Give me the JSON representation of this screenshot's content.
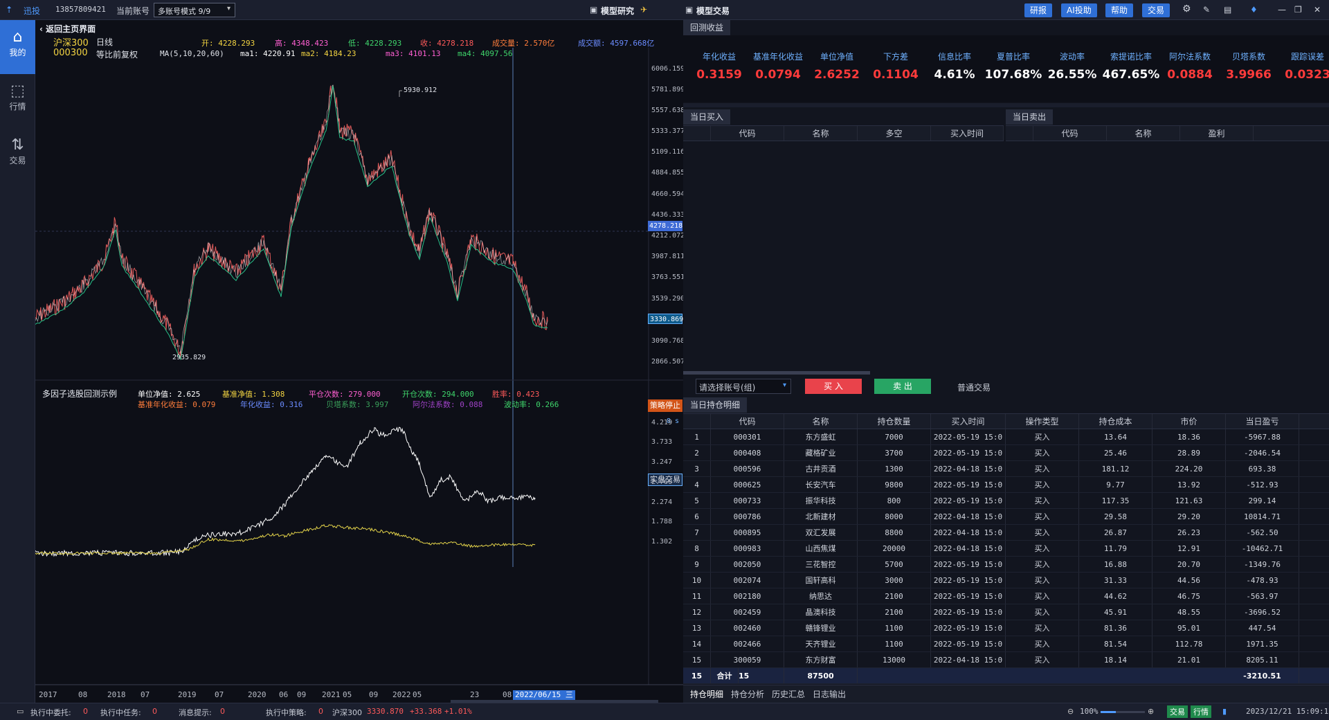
{
  "topbar": {
    "app_name": "迅投",
    "account_id": "13857809421",
    "current_account_label": "当前账号",
    "account_mode": "多账号模式 9/9",
    "model_research": "模型研究",
    "model_trade": "模型交易",
    "buttons": [
      "研报",
      "AI投助",
      "帮助",
      "交易"
    ]
  },
  "leftnav": [
    {
      "label": "我的",
      "icon": "home-icon"
    },
    {
      "label": "行情",
      "icon": "chart-icon"
    },
    {
      "label": "交易",
      "icon": "trade-icon"
    }
  ],
  "chart": {
    "back_label": "返回主页界面",
    "index_name": "沪深300",
    "period": "日线",
    "code": "000300",
    "adjust": "等比前复权",
    "ma_label": "MA(5,10,20,60)",
    "open": "开: 4228.293",
    "high": "高: 4348.423",
    "low": "低: 4228.293",
    "close": "收: 4278.218",
    "volume": "成交量: 2.570亿",
    "amount": "成交额: 4597.668亿",
    "ma1": "ma1: 4220.91",
    "ma2": "ma2: 4184.23",
    "ma3": "ma3: 4101.13",
    "ma4": "ma4: 4097.56",
    "peak_label": "5930.912",
    "trough_label": "2935.829",
    "current_tag": "4278.218",
    "last_tag": "3330.869",
    "crosshair_date": "2022/06/15 三",
    "strategy_title": "多因子选股回测示例",
    "s_unit_nav": "单位净值: 2.625",
    "s_bench_nav": "基准净值: 1.308",
    "s_close_count": "平仓次数: 279.000",
    "s_open_count": "开仓次数: 294.000",
    "s_win_rate": "胜率: 0.423",
    "s_bench_annual": "基准年化收益: 0.079",
    "s_annual": "年化收益: 0.316",
    "s_beta": "贝塔系数: 3.997",
    "s_alpha": "阿尔法系数: 0.088",
    "s_vol": "波动率: 0.266",
    "strategy_stop": "策略停止",
    "strategy_seconds": "8 s",
    "live_trade": "实盘交易",
    "price_axis": [
      "6006.159",
      "5781.899",
      "5557.638",
      "5333.377",
      "5109.116",
      "4884.855",
      "4660.594",
      "4436.333",
      "4212.072",
      "3987.811",
      "3763.551",
      "3539.290",
      "3090.768",
      "2866.507"
    ],
    "nav_axis": [
      "4.219",
      "3.733",
      "3.247",
      "2.760",
      "2.274",
      "1.788",
      "1.302"
    ],
    "x_axis": [
      "2017",
      "08",
      "2018",
      "07",
      "2019",
      "07",
      "2020",
      "06",
      "09",
      "2021",
      "05",
      "09",
      "2022",
      "05",
      "23",
      "08",
      "12"
    ]
  },
  "right": {
    "backtest_tab": "回测收益",
    "metrics": [
      {
        "k": "年化收益",
        "v": "0.3159",
        "c": "#ff3b3b"
      },
      {
        "k": "基准年化收益",
        "v": "0.0794",
        "c": "#ff3b3b"
      },
      {
        "k": "单位净值",
        "v": "2.6252",
        "c": "#ff3b3b"
      },
      {
        "k": "下方差",
        "v": "0.1104",
        "c": "#ff3b3b"
      },
      {
        "k": "信息比率",
        "v": "4.61%",
        "c": "#ffffff"
      },
      {
        "k": "夏普比率",
        "v": "107.68%",
        "c": "#ffffff"
      },
      {
        "k": "波动率",
        "v": "26.55%",
        "c": "#ffffff"
      },
      {
        "k": "索提诺比率",
        "v": "467.65%",
        "c": "#ffffff"
      },
      {
        "k": "阿尔法系数",
        "v": "0.0884",
        "c": "#ff3b3b"
      },
      {
        "k": "贝塔系数",
        "v": "3.9966",
        "c": "#ff3b3b"
      },
      {
        "k": "跟踪误差",
        "v": "0.0323",
        "c": "#ff3b3b"
      }
    ],
    "buy_tab": "当日买入",
    "sell_tab": "当日卖出",
    "buy_cols": [
      "代码",
      "名称",
      "多空",
      "买入时间"
    ],
    "sell_cols": [
      "代码",
      "名称",
      "盈利"
    ],
    "select_account": "请选择账号(组)",
    "buy_btn": "买 入",
    "sell_btn": "卖 出",
    "normal_trade": "普通交易",
    "pos_tab": "当日持仓明细",
    "pos_cols": [
      "",
      "代码",
      "名称",
      "持仓数量",
      "买入时间",
      "操作类型",
      "持仓成本",
      "市价",
      "当日盈亏"
    ],
    "positions": [
      [
        "1",
        "000301",
        "东方盛虹",
        "7000",
        "2022-05-19 15:0",
        "买入",
        "13.64",
        "18.36",
        "-5967.88"
      ],
      [
        "2",
        "000408",
        "藏格矿业",
        "3700",
        "2022-05-19 15:0",
        "买入",
        "25.46",
        "28.89",
        "-2046.54"
      ],
      [
        "3",
        "000596",
        "古井贡酒",
        "1300",
        "2022-04-18 15:0",
        "买入",
        "181.12",
        "224.20",
        "693.38"
      ],
      [
        "4",
        "000625",
        "长安汽车",
        "9800",
        "2022-05-19 15:0",
        "买入",
        "9.77",
        "13.92",
        "-512.93"
      ],
      [
        "5",
        "000733",
        "振华科技",
        "800",
        "2022-05-19 15:0",
        "买入",
        "117.35",
        "121.63",
        "299.14"
      ],
      [
        "6",
        "000786",
        "北新建材",
        "8000",
        "2022-04-18 15:0",
        "买入",
        "29.58",
        "29.20",
        "10814.71"
      ],
      [
        "7",
        "000895",
        "双汇发展",
        "8800",
        "2022-04-18 15:0",
        "买入",
        "26.87",
        "26.23",
        "-562.50"
      ],
      [
        "8",
        "000983",
        "山西焦煤",
        "20000",
        "2022-04-18 15:0",
        "买入",
        "11.79",
        "12.91",
        "-10462.71"
      ],
      [
        "9",
        "002050",
        "三花智控",
        "5700",
        "2022-05-19 15:0",
        "买入",
        "16.88",
        "20.70",
        "-1349.76"
      ],
      [
        "10",
        "002074",
        "国轩高科",
        "3000",
        "2022-05-19 15:0",
        "买入",
        "31.33",
        "44.56",
        "-478.93"
      ],
      [
        "11",
        "002180",
        "纳思达",
        "2100",
        "2022-05-19 15:0",
        "买入",
        "44.62",
        "46.75",
        "-563.97"
      ],
      [
        "12",
        "002459",
        "晶澳科技",
        "2100",
        "2022-05-19 15:0",
        "买入",
        "45.91",
        "48.55",
        "-3696.52"
      ],
      [
        "13",
        "002460",
        "赣锋锂业",
        "1100",
        "2022-05-19 15:0",
        "买入",
        "81.36",
        "95.01",
        "447.54"
      ],
      [
        "14",
        "002466",
        "天齐锂业",
        "1100",
        "2022-05-19 15:0",
        "买入",
        "81.54",
        "112.78",
        "1971.35"
      ],
      [
        "15",
        "300059",
        "东方财富",
        "13000",
        "2022-04-18 15:0",
        "买入",
        "18.14",
        "21.01",
        "8205.11"
      ]
    ],
    "total_row": [
      "15",
      "合计",
      "15",
      "87500",
      "-3210.51"
    ],
    "bottom_tabs": [
      "持仓明细",
      "持仓分析",
      "历史汇总",
      "日志输出"
    ]
  },
  "status": {
    "pending_orders": "执行中委托:",
    "pending_orders_n": "0",
    "running_tasks": "执行中任务:",
    "running_tasks_n": "0",
    "message": "消息提示:",
    "message_n": "0",
    "running_strategy": "执行中策略:",
    "running_strategy_n": "0",
    "index": "沪深300",
    "index_value": "3330.870",
    "index_change": "+33.368",
    "index_pct": "+1.01%",
    "zoom": "100%",
    "trade_btn": "交易",
    "quote_btn": "行情",
    "datetime": "2023/12/21 15:09:15"
  }
}
